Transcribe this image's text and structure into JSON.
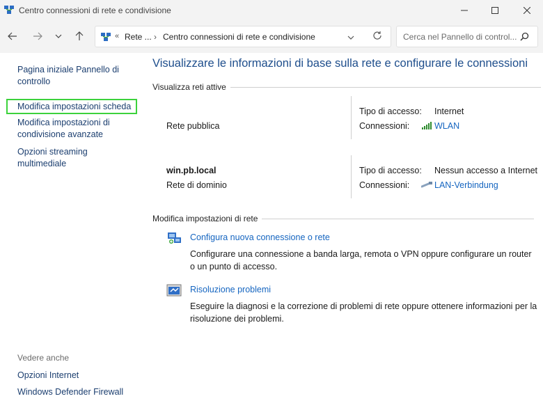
{
  "window": {
    "title": "Centro connessioni di rete e condivisione"
  },
  "nav": {
    "address_chevron": "«",
    "breadcrumb_1": "Rete ...",
    "breadcrumb_sep": "›",
    "breadcrumb_2": "Centro connessioni di rete e condivisione",
    "search_placeholder": "Cerca nel Pannello di control..."
  },
  "sidebar": {
    "home": "Pagina iniziale Pannello di controllo",
    "adapter_settings": "Modifica impostazioni scheda",
    "advanced_sharing": "Modifica impostazioni di condivisione avanzate",
    "media_streaming": "Opzioni streaming multimediale",
    "see_also": "Vedere anche",
    "internet_options": "Opzioni Internet",
    "firewall": "Windows Defender Firewall"
  },
  "main": {
    "title": "Visualizzare le informazioni di base sulla rete e configurare le connessioni",
    "active_networks_header": "Visualizza reti attive",
    "networks": [
      {
        "name": "",
        "type": "Rete pubblica",
        "access_label": "Tipo di accesso:",
        "access_value": "Internet",
        "connections_label": "Connessioni:",
        "connection": "WLAN",
        "connection_icon": "wifi-signal-icon"
      },
      {
        "name": "win.pb.local",
        "type": "Rete di dominio",
        "access_label": "Tipo di accesso:",
        "access_value": "Nessun accesso a Internet",
        "connections_label": "Connessioni:",
        "connection": "LAN-Verbindung",
        "connection_icon": "ethernet-cable-icon"
      }
    ],
    "change_settings_header": "Modifica impostazioni di rete",
    "tasks": [
      {
        "link": "Configura nuova connessione o rete",
        "description": "Configurare una connessione a banda larga, remota o VPN oppure configurare un router o un punto di accesso.",
        "icon": "new-connection-icon"
      },
      {
        "link": "Risoluzione problemi",
        "description": "Eseguire la diagnosi e la correzione di problemi di rete oppure ottenere informazioni per la risoluzione dei problemi.",
        "icon": "troubleshoot-icon"
      }
    ]
  },
  "colors": {
    "link": "#1565c0",
    "sidebar_link": "#1b3e6f",
    "title": "#1e4e8c",
    "highlight_border": "#3cd23c",
    "chrome_bg": "#f3f3f3"
  }
}
